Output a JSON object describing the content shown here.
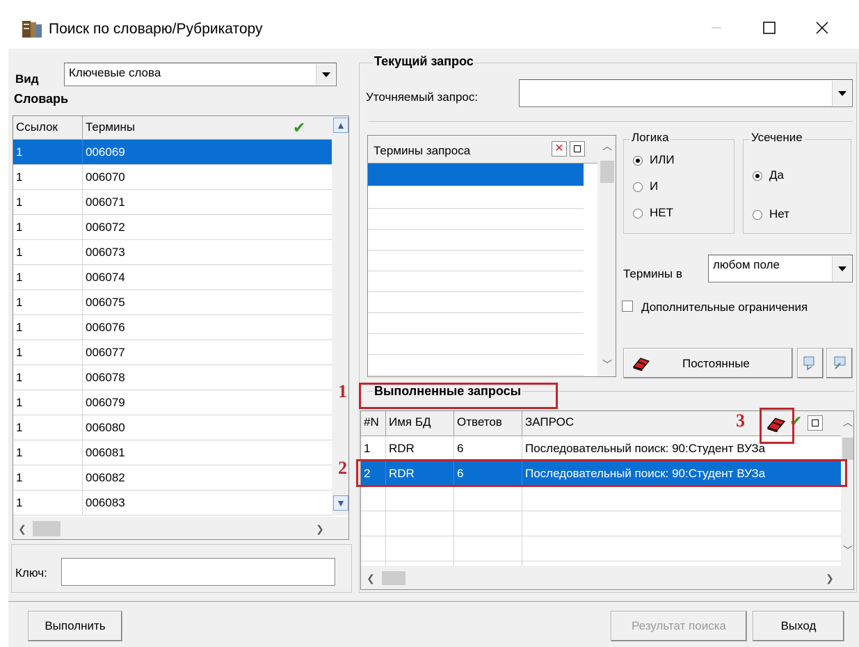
{
  "window": {
    "title": "Поиск по словарю/Рубрикатору",
    "app_icon": "book-stack-icon",
    "controls": [
      "minimize-icon",
      "maximize-icon",
      "close-icon"
    ]
  },
  "left": {
    "view_label": "Вид",
    "view_value": "Ключевые слова",
    "dictionary_label": "Словарь",
    "columns": [
      "Ссылок",
      "Термины"
    ],
    "rows": [
      {
        "refs": "1",
        "term": "006069"
      },
      {
        "refs": "1",
        "term": "006070"
      },
      {
        "refs": "1",
        "term": "006071"
      },
      {
        "refs": "1",
        "term": "006072"
      },
      {
        "refs": "1",
        "term": "006073"
      },
      {
        "refs": "1",
        "term": "006074"
      },
      {
        "refs": "1",
        "term": "006075"
      },
      {
        "refs": "1",
        "term": "006076"
      },
      {
        "refs": "1",
        "term": "006077"
      },
      {
        "refs": "1",
        "term": "006078"
      },
      {
        "refs": "1",
        "term": "006079"
      },
      {
        "refs": "1",
        "term": "006080"
      },
      {
        "refs": "1",
        "term": "006081"
      },
      {
        "refs": "1",
        "term": "006082"
      },
      {
        "refs": "1",
        "term": "006083"
      }
    ],
    "selected_row": 0,
    "key_label": "Ключ:",
    "key_value": ""
  },
  "current": {
    "group_label": "Текущий запрос",
    "refine_label": "Уточняемый запрос:",
    "refine_value": "",
    "terms_header": "Термины запроса",
    "logic_label": "Логика",
    "logic_options": [
      "ИЛИ",
      "И",
      "НЕТ"
    ],
    "logic_selected": "ИЛИ",
    "trunc_label": "Усечение",
    "trunc_options": [
      "Да",
      "Нет"
    ],
    "trunc_selected": "Да",
    "terms_in_label": "Термины в",
    "terms_in_value": "любом поле",
    "extra_label": "Дополнительные ограничения",
    "extra_checked": false,
    "permanent_label": "Постоянные"
  },
  "executed": {
    "group_label": "Выполненные запросы",
    "columns": [
      "#N",
      "Имя БД",
      "Ответов",
      "ЗАПРОС"
    ],
    "rows": [
      {
        "n": "1",
        "db": "RDR",
        "answers": "6",
        "query": "Последовательный поиск: 90:Студент ВУЗа"
      },
      {
        "n": "2",
        "db": "RDR",
        "answers": "6",
        "query": "Последовательный поиск: 90:Студент ВУЗа"
      }
    ],
    "selected_row": 1
  },
  "annotations": [
    "1",
    "2",
    "3"
  ],
  "buttons": {
    "execute": "Выполнить",
    "result": "Результат поиска",
    "exit": "Выход"
  },
  "colors": {
    "selection": "#0a6fd2",
    "annotation": "#c0272d",
    "check_green": "#2e9a1e"
  }
}
